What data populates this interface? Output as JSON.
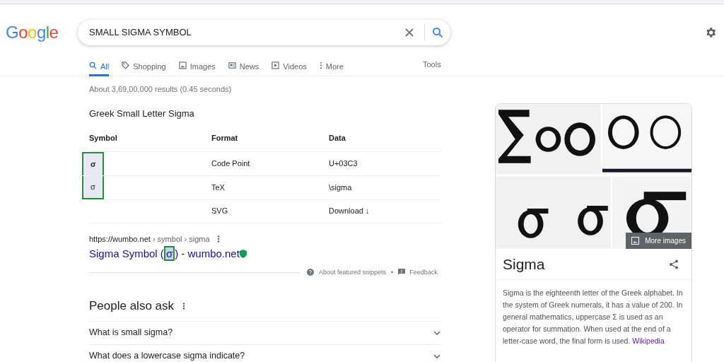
{
  "logo": "Google",
  "search": {
    "value": "SMALL SIGMA SYMBOL"
  },
  "tabs": [
    {
      "label": "All",
      "selected": true
    },
    {
      "label": "Shopping",
      "selected": false
    },
    {
      "label": "Images",
      "selected": false
    },
    {
      "label": "News",
      "selected": false
    },
    {
      "label": "Videos",
      "selected": false
    },
    {
      "label": "More",
      "selected": false
    }
  ],
  "tools": "Tools",
  "result_stats": "About 3,69,00,000 results (0.45 seconds)",
  "snippet": {
    "heading": "Greek Small Letter Sigma",
    "table": {
      "columns": [
        "Symbol",
        "Format",
        "Data"
      ],
      "rows": [
        {
          "symbol": "σ",
          "format": "Code Point",
          "data": "U+03C3",
          "highlighted": true,
          "bold": true
        },
        {
          "symbol": "σ",
          "format": "TeX",
          "data": "\\sigma",
          "highlighted": true,
          "bold": false
        },
        {
          "format": "SVG",
          "data": "Download ↓",
          "highlighted": false
        }
      ]
    },
    "source_url": "https://wumbo.net",
    "breadcrumb": " › symbol › sigma",
    "title_before": "Sigma Symbol (",
    "title_highlight": "σ",
    "title_after": ") - wumbo.net",
    "about": "About featured snippets",
    "separator": "•",
    "feedback": "Feedback"
  },
  "people_also_ask": {
    "heading": "People also ask",
    "questions": [
      "What is small sigma?",
      "What does a lowercase sigma indicate?"
    ]
  },
  "knowledge_panel": {
    "more_images": "More images",
    "title": "Sigma",
    "description": "Sigma is the eighteenth letter of the Greek alphabet. In the system of Greek numerals, it has a value of 200. In general mathematics, uppercase Σ is used as an operator for summation. When used at the end of a letter-case word, the final form is used.",
    "source": "Wikipedia"
  }
}
